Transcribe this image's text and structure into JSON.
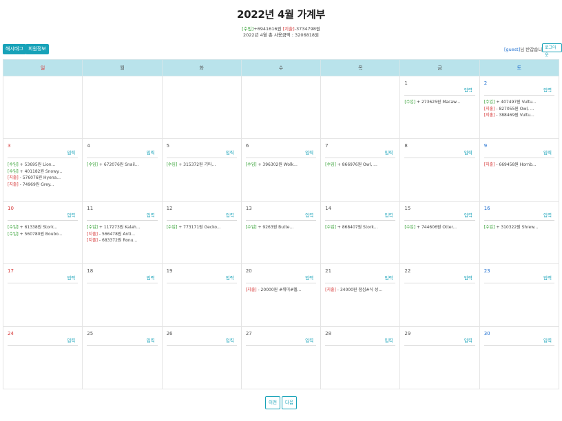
{
  "title": "2022년 4월 가계부",
  "summary": {
    "income_tag": "[수입]",
    "income_value": "+6941616원",
    "expense_tag": "[지출]",
    "expense_value": "-3734798원",
    "total": "2022년 4월 총 사용금액 : 3206818원"
  },
  "buttons": {
    "hashtag": "해시태그",
    "member_info": "회원정보",
    "logout": "로그아웃",
    "prev": "이전",
    "next": "다음"
  },
  "greeting": {
    "user": "[guest]",
    "text": "님 반갑습니다."
  },
  "weekdays": [
    "일",
    "월",
    "화",
    "수",
    "목",
    "금",
    "토"
  ],
  "add_label": "입력",
  "weeks": [
    [
      {
        "day": "",
        "entries": []
      },
      {
        "day": "",
        "entries": []
      },
      {
        "day": "",
        "entries": []
      },
      {
        "day": "",
        "entries": []
      },
      {
        "day": "",
        "entries": []
      },
      {
        "day": "1",
        "entries": [
          {
            "tag": "[수입]",
            "text": " + 273625원 Macaw..."
          }
        ]
      },
      {
        "day": "2",
        "entries": [
          {
            "tag": "[수입]",
            "text": " + 407497원 Vultu..."
          },
          {
            "tag": "[지출]",
            "text": " - 827055원 Owl, ..."
          },
          {
            "tag": "[지출]",
            "text": " - 388469원 Vultu..."
          }
        ]
      }
    ],
    [
      {
        "day": "3",
        "entries": [
          {
            "tag": "[수입]",
            "text": " + 53695원 Lion..."
          },
          {
            "tag": "[수입]",
            "text": " + 401182원 Snowy..."
          },
          {
            "tag": "[지출]",
            "text": " - 576076원 Hyena..."
          },
          {
            "tag": "[지출]",
            "text": " - 74969원 Grey..."
          }
        ]
      },
      {
        "day": "4",
        "entries": [
          {
            "tag": "[수입]",
            "text": " + 672076원 Snail..."
          }
        ]
      },
      {
        "day": "5",
        "entries": [
          {
            "tag": "[수입]",
            "text": " + 315372원 기타..."
          }
        ]
      },
      {
        "day": "6",
        "entries": [
          {
            "tag": "[수입]",
            "text": " + 396302원 Wolk..."
          }
        ]
      },
      {
        "day": "7",
        "entries": [
          {
            "tag": "[수입]",
            "text": " + 866976원 Owl, ..."
          }
        ]
      },
      {
        "day": "8",
        "entries": []
      },
      {
        "day": "9",
        "entries": [
          {
            "tag": "[지출]",
            "text": " - 669458원 Hornb..."
          }
        ]
      }
    ],
    [
      {
        "day": "10",
        "entries": [
          {
            "tag": "[수입]",
            "text": " + 61338원 Stork..."
          },
          {
            "tag": "[수입]",
            "text": " + 560780원 Boubo..."
          }
        ]
      },
      {
        "day": "11",
        "entries": [
          {
            "tag": "[수입]",
            "text": " + 117273원 Kalah..."
          },
          {
            "tag": "[지출]",
            "text": " - 566478원 Anti..."
          },
          {
            "tag": "[지출]",
            "text": " - 683372원 Ronu..."
          }
        ]
      },
      {
        "day": "12",
        "entries": [
          {
            "tag": "[수입]",
            "text": " + 773171원 Gecko..."
          }
        ]
      },
      {
        "day": "13",
        "entries": [
          {
            "tag": "[수입]",
            "text": " + 9263원 Butte..."
          }
        ]
      },
      {
        "day": "14",
        "entries": [
          {
            "tag": "[수입]",
            "text": " + 868407원 Stork..."
          }
        ]
      },
      {
        "day": "15",
        "entries": [
          {
            "tag": "[수입]",
            "text": " + 744606원 Otter..."
          }
        ]
      },
      {
        "day": "16",
        "entries": [
          {
            "tag": "[수입]",
            "text": " + 310322원 Shrew..."
          }
        ]
      }
    ],
    [
      {
        "day": "17",
        "entries": []
      },
      {
        "day": "18",
        "entries": []
      },
      {
        "day": "19",
        "entries": []
      },
      {
        "day": "20",
        "entries": [
          {
            "tag": "[지출]",
            "text": " - 20000원 #취미#헬..."
          }
        ]
      },
      {
        "day": "21",
        "entries": [
          {
            "tag": "[지출]",
            "text": " - 34000원 점심#식 성..."
          }
        ]
      },
      {
        "day": "22",
        "entries": []
      },
      {
        "day": "23",
        "entries": []
      }
    ],
    [
      {
        "day": "24",
        "entries": []
      },
      {
        "day": "25",
        "entries": []
      },
      {
        "day": "26",
        "entries": []
      },
      {
        "day": "27",
        "entries": []
      },
      {
        "day": "28",
        "entries": []
      },
      {
        "day": "29",
        "entries": []
      },
      {
        "day": "30",
        "entries": []
      }
    ]
  ]
}
